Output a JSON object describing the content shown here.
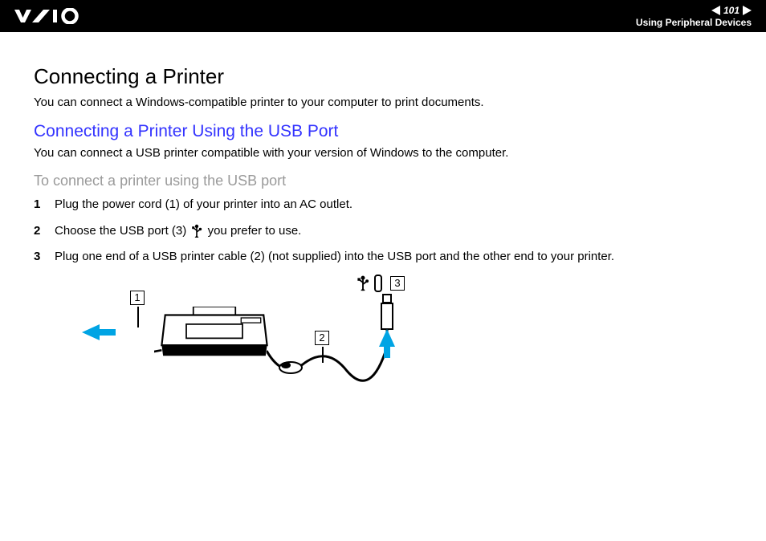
{
  "header": {
    "page_number": "101",
    "section": "Using Peripheral Devices"
  },
  "title": "Connecting a Printer",
  "intro": "You can connect a Windows-compatible printer to your computer to print documents.",
  "subheading": "Connecting a Printer Using the USB Port",
  "subintro": "You can connect a USB printer compatible with your version of Windows to the computer.",
  "task_heading": "To connect a printer using the USB port",
  "steps": [
    {
      "num": "1",
      "text": "Plug the power cord (1) of your printer into an AC outlet."
    },
    {
      "num": "2",
      "before": "Choose the USB port (3) ",
      "after": " you prefer to use."
    },
    {
      "num": "3",
      "text": "Plug one end of a USB printer cable (2) (not supplied) into the USB port and the other end to your printer."
    }
  ],
  "diagram": {
    "callout1": "1",
    "callout2": "2",
    "callout3": "3"
  }
}
